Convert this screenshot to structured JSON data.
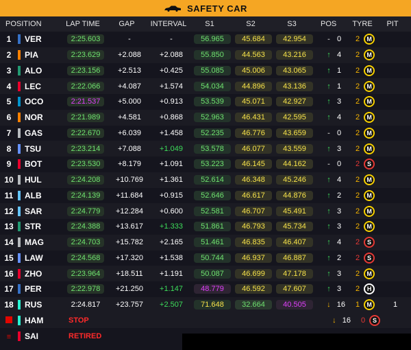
{
  "banner": {
    "title": "SAFETY CAR",
    "icon": "safety-car-icon"
  },
  "headers": {
    "position": "POSITION",
    "lap_time": "LAP TIME",
    "gap": "GAP",
    "interval": "INTERVAL",
    "s1": "S1",
    "s2": "S2",
    "s3": "S3",
    "pos": "POS",
    "tyre": "TYRE",
    "pit": "PIT"
  },
  "colors": {
    "banner": "#f5a623",
    "purple_sector": "#e040fb",
    "yellow_sector": "#f7e34a",
    "green_sector": "#6fe26f",
    "position_up": "#3ddc5a",
    "position_down": "#f5b400",
    "status_red": "#ff2a2a"
  },
  "rows": [
    {
      "pos": "1",
      "team": "#3671c6",
      "drv": "VER",
      "lap": "2:25.603",
      "lapc": "lap",
      "gap": "-",
      "int": "-",
      "intc": "",
      "s1": "56.965",
      "s1c": "green",
      "s2": "45.684",
      "s2c": "yellow",
      "s3": "42.954",
      "s3c": "yellow",
      "dir": "eq",
      "chg": "0",
      "tn": "2",
      "tc": "M",
      "pit": ""
    },
    {
      "pos": "2",
      "team": "#ff8000",
      "drv": "PIA",
      "lap": "2:23.629",
      "lapc": "lap",
      "gap": "+2.088",
      "int": "+2.088",
      "intc": "",
      "s1": "55.850",
      "s1c": "green",
      "s2": "44.563",
      "s2c": "yellow",
      "s3": "43.216",
      "s3c": "yellow",
      "dir": "up",
      "chg": "4",
      "tn": "2",
      "tc": "M",
      "pit": ""
    },
    {
      "pos": "3",
      "team": "#229971",
      "drv": "ALO",
      "lap": "2:23.156",
      "lapc": "lap",
      "gap": "+2.513",
      "int": "+0.425",
      "intc": "",
      "s1": "55.085",
      "s1c": "green",
      "s2": "45.006",
      "s2c": "yellow",
      "s3": "43.065",
      "s3c": "yellow",
      "dir": "up",
      "chg": "1",
      "tn": "2",
      "tc": "M",
      "pit": ""
    },
    {
      "pos": "4",
      "team": "#e8002d",
      "drv": "LEC",
      "lap": "2:22.066",
      "lapc": "lap",
      "gap": "+4.087",
      "int": "+1.574",
      "intc": "",
      "s1": "54.034",
      "s1c": "green",
      "s2": "44.896",
      "s2c": "yellow",
      "s3": "43.136",
      "s3c": "yellow",
      "dir": "up",
      "chg": "1",
      "tn": "2",
      "tc": "M",
      "pit": ""
    },
    {
      "pos": "5",
      "team": "#0093cc",
      "drv": "OCO",
      "lap": "2:21.537",
      "lapc": "purple",
      "gap": "+5.000",
      "int": "+0.913",
      "intc": "",
      "s1": "53.539",
      "s1c": "green",
      "s2": "45.071",
      "s2c": "yellow",
      "s3": "42.927",
      "s3c": "yellow",
      "dir": "up",
      "chg": "3",
      "tn": "2",
      "tc": "M",
      "pit": ""
    },
    {
      "pos": "6",
      "team": "#ff8000",
      "drv": "NOR",
      "lap": "2:21.989",
      "lapc": "lap",
      "gap": "+4.581",
      "int": "+0.868",
      "intc": "",
      "s1": "52.963",
      "s1c": "green",
      "s2": "46.431",
      "s2c": "yellow",
      "s3": "42.595",
      "s3c": "yellow",
      "dir": "up",
      "chg": "4",
      "tn": "2",
      "tc": "M",
      "pit": ""
    },
    {
      "pos": "7",
      "team": "#b6babd",
      "drv": "GAS",
      "lap": "2:22.670",
      "lapc": "lap",
      "gap": "+6.039",
      "int": "+1.458",
      "intc": "",
      "s1": "52.235",
      "s1c": "green",
      "s2": "46.776",
      "s2c": "yellow",
      "s3": "43.659",
      "s3c": "yellow",
      "dir": "eq",
      "chg": "0",
      "tn": "2",
      "tc": "M",
      "pit": ""
    },
    {
      "pos": "8",
      "team": "#6692ff",
      "drv": "TSU",
      "lap": "2:23.214",
      "lapc": "lap",
      "gap": "+7.088",
      "int": "+1.049",
      "intc": "green",
      "s1": "53.578",
      "s1c": "green",
      "s2": "46.077",
      "s2c": "yellow",
      "s3": "43.559",
      "s3c": "yellow",
      "dir": "up",
      "chg": "3",
      "tn": "2",
      "tc": "M",
      "pit": ""
    },
    {
      "pos": "9",
      "team": "#e8002d",
      "drv": "BOT",
      "lap": "2:23.530",
      "lapc": "lap",
      "gap": "+8.179",
      "int": "+1.091",
      "intc": "",
      "s1": "53.223",
      "s1c": "green",
      "s2": "46.145",
      "s2c": "yellow",
      "s3": "44.162",
      "s3c": "yellow",
      "dir": "eq",
      "chg": "0",
      "tn": "2",
      "tc": "S",
      "pit": ""
    },
    {
      "pos": "10",
      "team": "#b6babd",
      "drv": "HUL",
      "lap": "2:24.208",
      "lapc": "lap",
      "gap": "+10.769",
      "int": "+1.361",
      "intc": "",
      "s1": "52.614",
      "s1c": "green",
      "s2": "46.348",
      "s2c": "yellow",
      "s3": "45.246",
      "s3c": "yellow",
      "dir": "up",
      "chg": "4",
      "tn": "2",
      "tc": "M",
      "pit": ""
    },
    {
      "pos": "11",
      "team": "#64c4ff",
      "drv": "ALB",
      "lap": "2:24.139",
      "lapc": "lap",
      "gap": "+11.684",
      "int": "+0.915",
      "intc": "",
      "s1": "52.646",
      "s1c": "green",
      "s2": "46.617",
      "s2c": "yellow",
      "s3": "44.876",
      "s3c": "yellow",
      "dir": "up",
      "chg": "2",
      "tn": "2",
      "tc": "M",
      "pit": ""
    },
    {
      "pos": "12",
      "team": "#64c4ff",
      "drv": "SAR",
      "lap": "2:24.779",
      "lapc": "lap",
      "gap": "+12.284",
      "int": "+0.600",
      "intc": "",
      "s1": "52.581",
      "s1c": "green",
      "s2": "46.707",
      "s2c": "yellow",
      "s3": "45.491",
      "s3c": "yellow",
      "dir": "up",
      "chg": "3",
      "tn": "2",
      "tc": "M",
      "pit": ""
    },
    {
      "pos": "13",
      "team": "#229971",
      "drv": "STR",
      "lap": "2:24.388",
      "lapc": "lap",
      "gap": "+13.617",
      "int": "+1.333",
      "intc": "green",
      "s1": "51.861",
      "s1c": "green",
      "s2": "46.793",
      "s2c": "yellow",
      "s3": "45.734",
      "s3c": "yellow",
      "dir": "up",
      "chg": "3",
      "tn": "2",
      "tc": "M",
      "pit": ""
    },
    {
      "pos": "14",
      "team": "#b6babd",
      "drv": "MAG",
      "lap": "2:24.703",
      "lapc": "lap",
      "gap": "+15.782",
      "int": "+2.165",
      "intc": "",
      "s1": "51.461",
      "s1c": "green",
      "s2": "46.835",
      "s2c": "yellow",
      "s3": "46.407",
      "s3c": "yellow",
      "dir": "up",
      "chg": "4",
      "tn": "2",
      "tc": "S",
      "pit": ""
    },
    {
      "pos": "15",
      "team": "#6692ff",
      "drv": "LAW",
      "lap": "2:24.568",
      "lapc": "lap",
      "gap": "+17.320",
      "int": "+1.538",
      "intc": "",
      "s1": "50.744",
      "s1c": "green",
      "s2": "46.937",
      "s2c": "yellow",
      "s3": "46.887",
      "s3c": "yellow",
      "dir": "up",
      "chg": "2",
      "tn": "2",
      "tc": "S",
      "pit": ""
    },
    {
      "pos": "16",
      "team": "#e8002d",
      "drv": "ZHO",
      "lap": "2:23.964",
      "lapc": "lap",
      "gap": "+18.511",
      "int": "+1.191",
      "intc": "",
      "s1": "50.087",
      "s1c": "green",
      "s2": "46.699",
      "s2c": "yellow",
      "s3": "47.178",
      "s3c": "yellow",
      "dir": "up",
      "chg": "3",
      "tn": "2",
      "tc": "M",
      "pit": ""
    },
    {
      "pos": "17",
      "team": "#3671c6",
      "drv": "PER",
      "lap": "2:22.978",
      "lapc": "lap",
      "gap": "+21.250",
      "int": "+1.147",
      "intc": "green",
      "s1": "48.779",
      "s1c": "purple",
      "s2": "46.592",
      "s2c": "yellow",
      "s3": "47.607",
      "s3c": "yellow",
      "dir": "up",
      "chg": "3",
      "tn": "2",
      "tc": "H",
      "pit": ""
    },
    {
      "pos": "18",
      "team": "#27f4d2",
      "drv": "RUS",
      "lap": "2:24.817",
      "lapc": "plain",
      "gap": "+23.757",
      "int": "+2.507",
      "intc": "green",
      "s1": "71.648",
      "s1c": "yellow",
      "s2": "32.664",
      "s2c": "green",
      "s3": "40.505",
      "s3c": "purple",
      "dir": "dn",
      "chg": "16",
      "tn": "1",
      "tc": "M",
      "pit": "1"
    }
  ],
  "out": [
    {
      "team": "#27f4d2",
      "drv": "HAM",
      "status": "STOP",
      "marker": "red-flag-icon",
      "dir": "dn",
      "chg": "16",
      "tn": "0",
      "tc": "S"
    },
    {
      "team": "#e8002d",
      "drv": "SAI",
      "status": "RETIRED",
      "marker": "menu-icon"
    }
  ]
}
